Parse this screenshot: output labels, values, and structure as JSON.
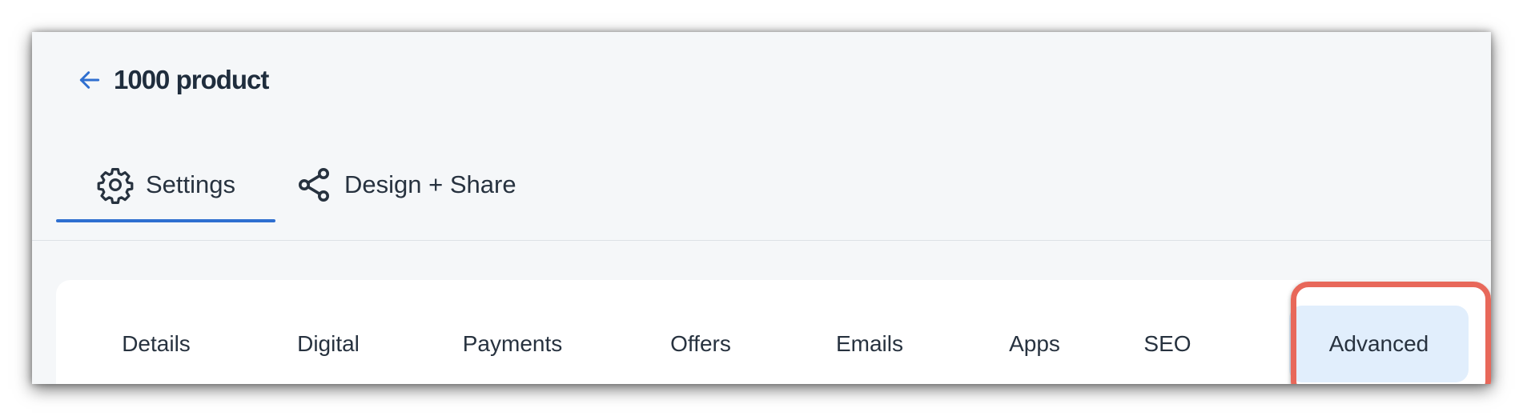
{
  "header": {
    "title": "1000 product",
    "back_icon": "arrow-left-icon"
  },
  "top_tabs": [
    {
      "label": "Settings",
      "icon": "gear-icon",
      "active": true
    },
    {
      "label": "Design + Share",
      "icon": "share-icon",
      "active": false
    }
  ],
  "sub_tabs": [
    {
      "label": "Details",
      "active": false
    },
    {
      "label": "Digital",
      "active": false
    },
    {
      "label": "Payments",
      "active": false
    },
    {
      "label": "Offers",
      "active": false
    },
    {
      "label": "Emails",
      "active": false
    },
    {
      "label": "Apps",
      "active": false
    },
    {
      "label": "SEO",
      "active": false
    },
    {
      "label": "Advanced",
      "active": true
    }
  ],
  "colors": {
    "accent": "#2f6fd0",
    "active_tab_bg": "#e1eefc",
    "highlight": "#e8685a"
  }
}
